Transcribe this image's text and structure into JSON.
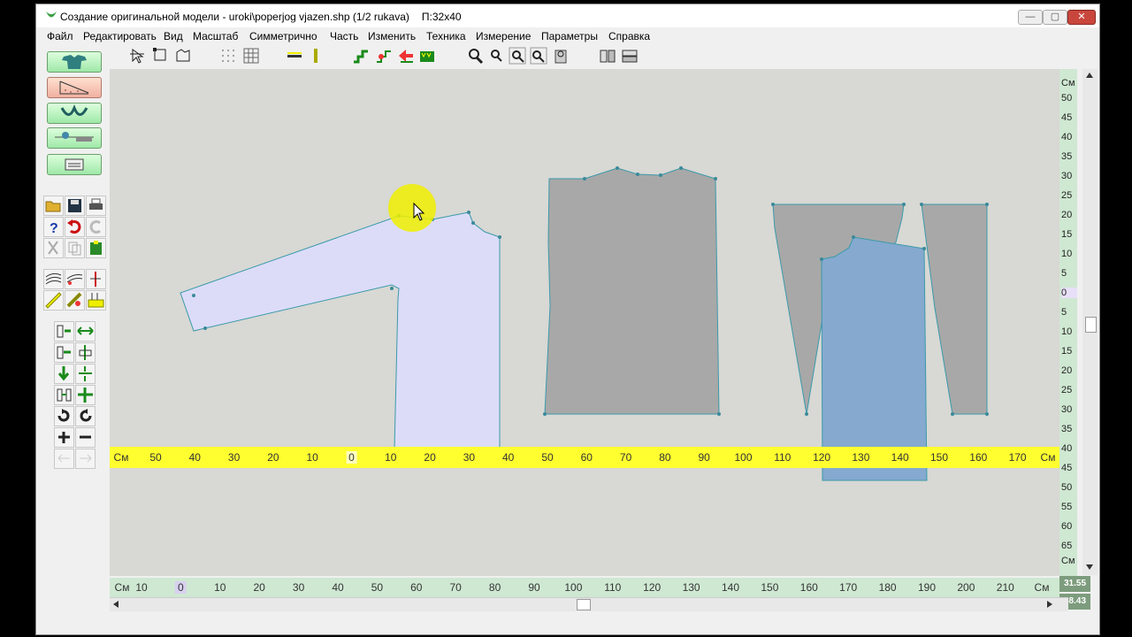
{
  "window": {
    "title": "Создание оригинальной модели - uroki\\poperjog vjazen.shp (1/2 rukava)",
    "size_label": "П:32x40",
    "controls": [
      "—",
      "▢",
      "✕"
    ]
  },
  "menu": [
    "Файл",
    "Редактировать",
    "Вид",
    "Масштаб",
    "Симметрично",
    "Часть",
    "Изменить",
    "Техника",
    "Измерение",
    "Параметры",
    "Справка"
  ],
  "colors": {
    "sleeve_piece": "#dcdcf8",
    "grey_piece": "#a8a8a8",
    "blue_piece": "#85a9cf",
    "highlight": "#f0f000",
    "ruler_yellow": "#ffff30",
    "ruler_green": "#cfe8d2"
  },
  "rulers": {
    "unit": "См",
    "yellow_ticks": [
      "50",
      "40",
      "30",
      "20",
      "10",
      "0",
      "10",
      "20",
      "30",
      "40",
      "50",
      "60",
      "70",
      "80",
      "90",
      "100",
      "110",
      "120",
      "130",
      "140",
      "150",
      "160",
      "170"
    ],
    "bottom_ticks": [
      "10",
      "0",
      "10",
      "20",
      "30",
      "40",
      "50",
      "60",
      "70",
      "80",
      "90",
      "100",
      "110",
      "120",
      "130",
      "140",
      "150",
      "160",
      "170",
      "180",
      "190",
      "200",
      "210"
    ],
    "vertical_ticks": [
      "50",
      "45",
      "40",
      "35",
      "30",
      "25",
      "20",
      "15",
      "10",
      "5",
      "0",
      "5",
      "10",
      "15",
      "20",
      "25",
      "30",
      "35",
      "40",
      "45",
      "50",
      "55",
      "60",
      "65"
    ]
  },
  "readouts": {
    "x": "31.55",
    "y": "48.43"
  }
}
